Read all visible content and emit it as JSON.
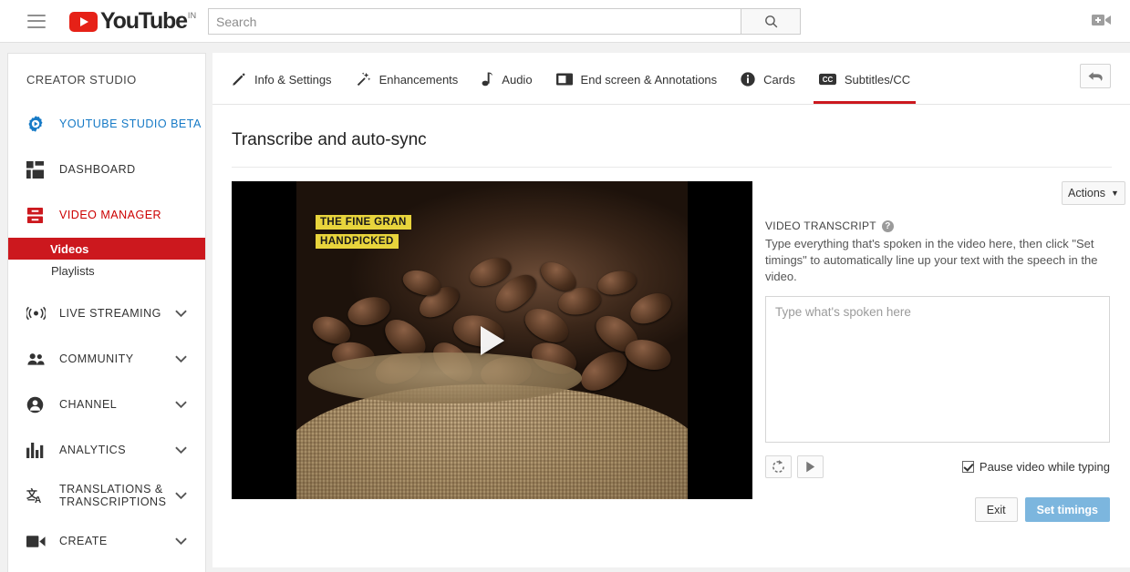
{
  "header": {
    "menu_icon": "hamburger-icon",
    "logo_text": "YouTube",
    "country_code": "IN",
    "search_placeholder": "Search",
    "search_value": "",
    "search_icon": "search-icon",
    "upload_icon": "upload-video-icon"
  },
  "sidebar": {
    "title": "CREATOR STUDIO",
    "items": [
      {
        "label": "YOUTUBE STUDIO BETA",
        "icon": "gear-play-icon",
        "style": "blue",
        "chevron": false
      },
      {
        "label": "DASHBOARD",
        "icon": "dashboard-icon",
        "style": "dark",
        "chevron": false
      },
      {
        "label": "VIDEO MANAGER",
        "icon": "video-manager-icon",
        "style": "red",
        "chevron": false
      }
    ],
    "sub_items": [
      {
        "label": "Videos",
        "active": true
      },
      {
        "label": "Playlists",
        "active": false
      }
    ],
    "items2": [
      {
        "label": "LIVE STREAMING",
        "icon": "live-streaming-icon",
        "chevron": true
      },
      {
        "label": "COMMUNITY",
        "icon": "community-icon",
        "chevron": true
      },
      {
        "label": "CHANNEL",
        "icon": "channel-icon",
        "chevron": true
      },
      {
        "label": "ANALYTICS",
        "icon": "analytics-icon",
        "chevron": true
      },
      {
        "label": "TRANSLATIONS & TRANSCRIPTIONS",
        "icon": "translations-icon",
        "chevron": true
      },
      {
        "label": "CREATE",
        "icon": "create-icon",
        "chevron": true
      }
    ]
  },
  "tabs": [
    {
      "label": "Info & Settings",
      "icon": "pencil-icon",
      "active": false
    },
    {
      "label": "Enhancements",
      "icon": "magic-wand-icon",
      "active": false
    },
    {
      "label": "Audio",
      "icon": "music-note-icon",
      "active": false
    },
    {
      "label": "End screen & Annotations",
      "icon": "end-screen-icon",
      "active": false
    },
    {
      "label": "Cards",
      "icon": "info-circle-icon",
      "active": false
    },
    {
      "label": "Subtitles/CC",
      "icon": "cc-icon",
      "active": true
    }
  ],
  "back_button_icon": "back-arrow-icon",
  "main": {
    "page_title": "Transcribe and auto-sync",
    "video": {
      "caption_line1": "THE FINE GRAN",
      "caption_line2": "HANDPICKED",
      "play_icon": "play-icon"
    },
    "actions_button": "Actions",
    "actions_caret": "▼",
    "transcript_label": "VIDEO TRANSCRIPT",
    "help_icon": "help-icon",
    "help_glyph": "?",
    "transcript_description": "Type everything that's spoken in the video here, then click \"Set timings\" to automatically line up your text with the speech in the video.",
    "transcript_placeholder": "Type what's spoken here",
    "transcript_value": "",
    "replay_icon": "replay-icon",
    "play_button_icon": "play-icon",
    "pause_checkbox_label": "Pause video while typing",
    "pause_checkbox_checked": true,
    "exit_button": "Exit",
    "set_timings_button": "Set timings"
  },
  "colors": {
    "youtube_red": "#e62117",
    "active_red": "#cc181e",
    "link_blue": "#167ac6",
    "set_timings_blue": "#7cb6de",
    "caption_yellow": "#e8d43c"
  }
}
